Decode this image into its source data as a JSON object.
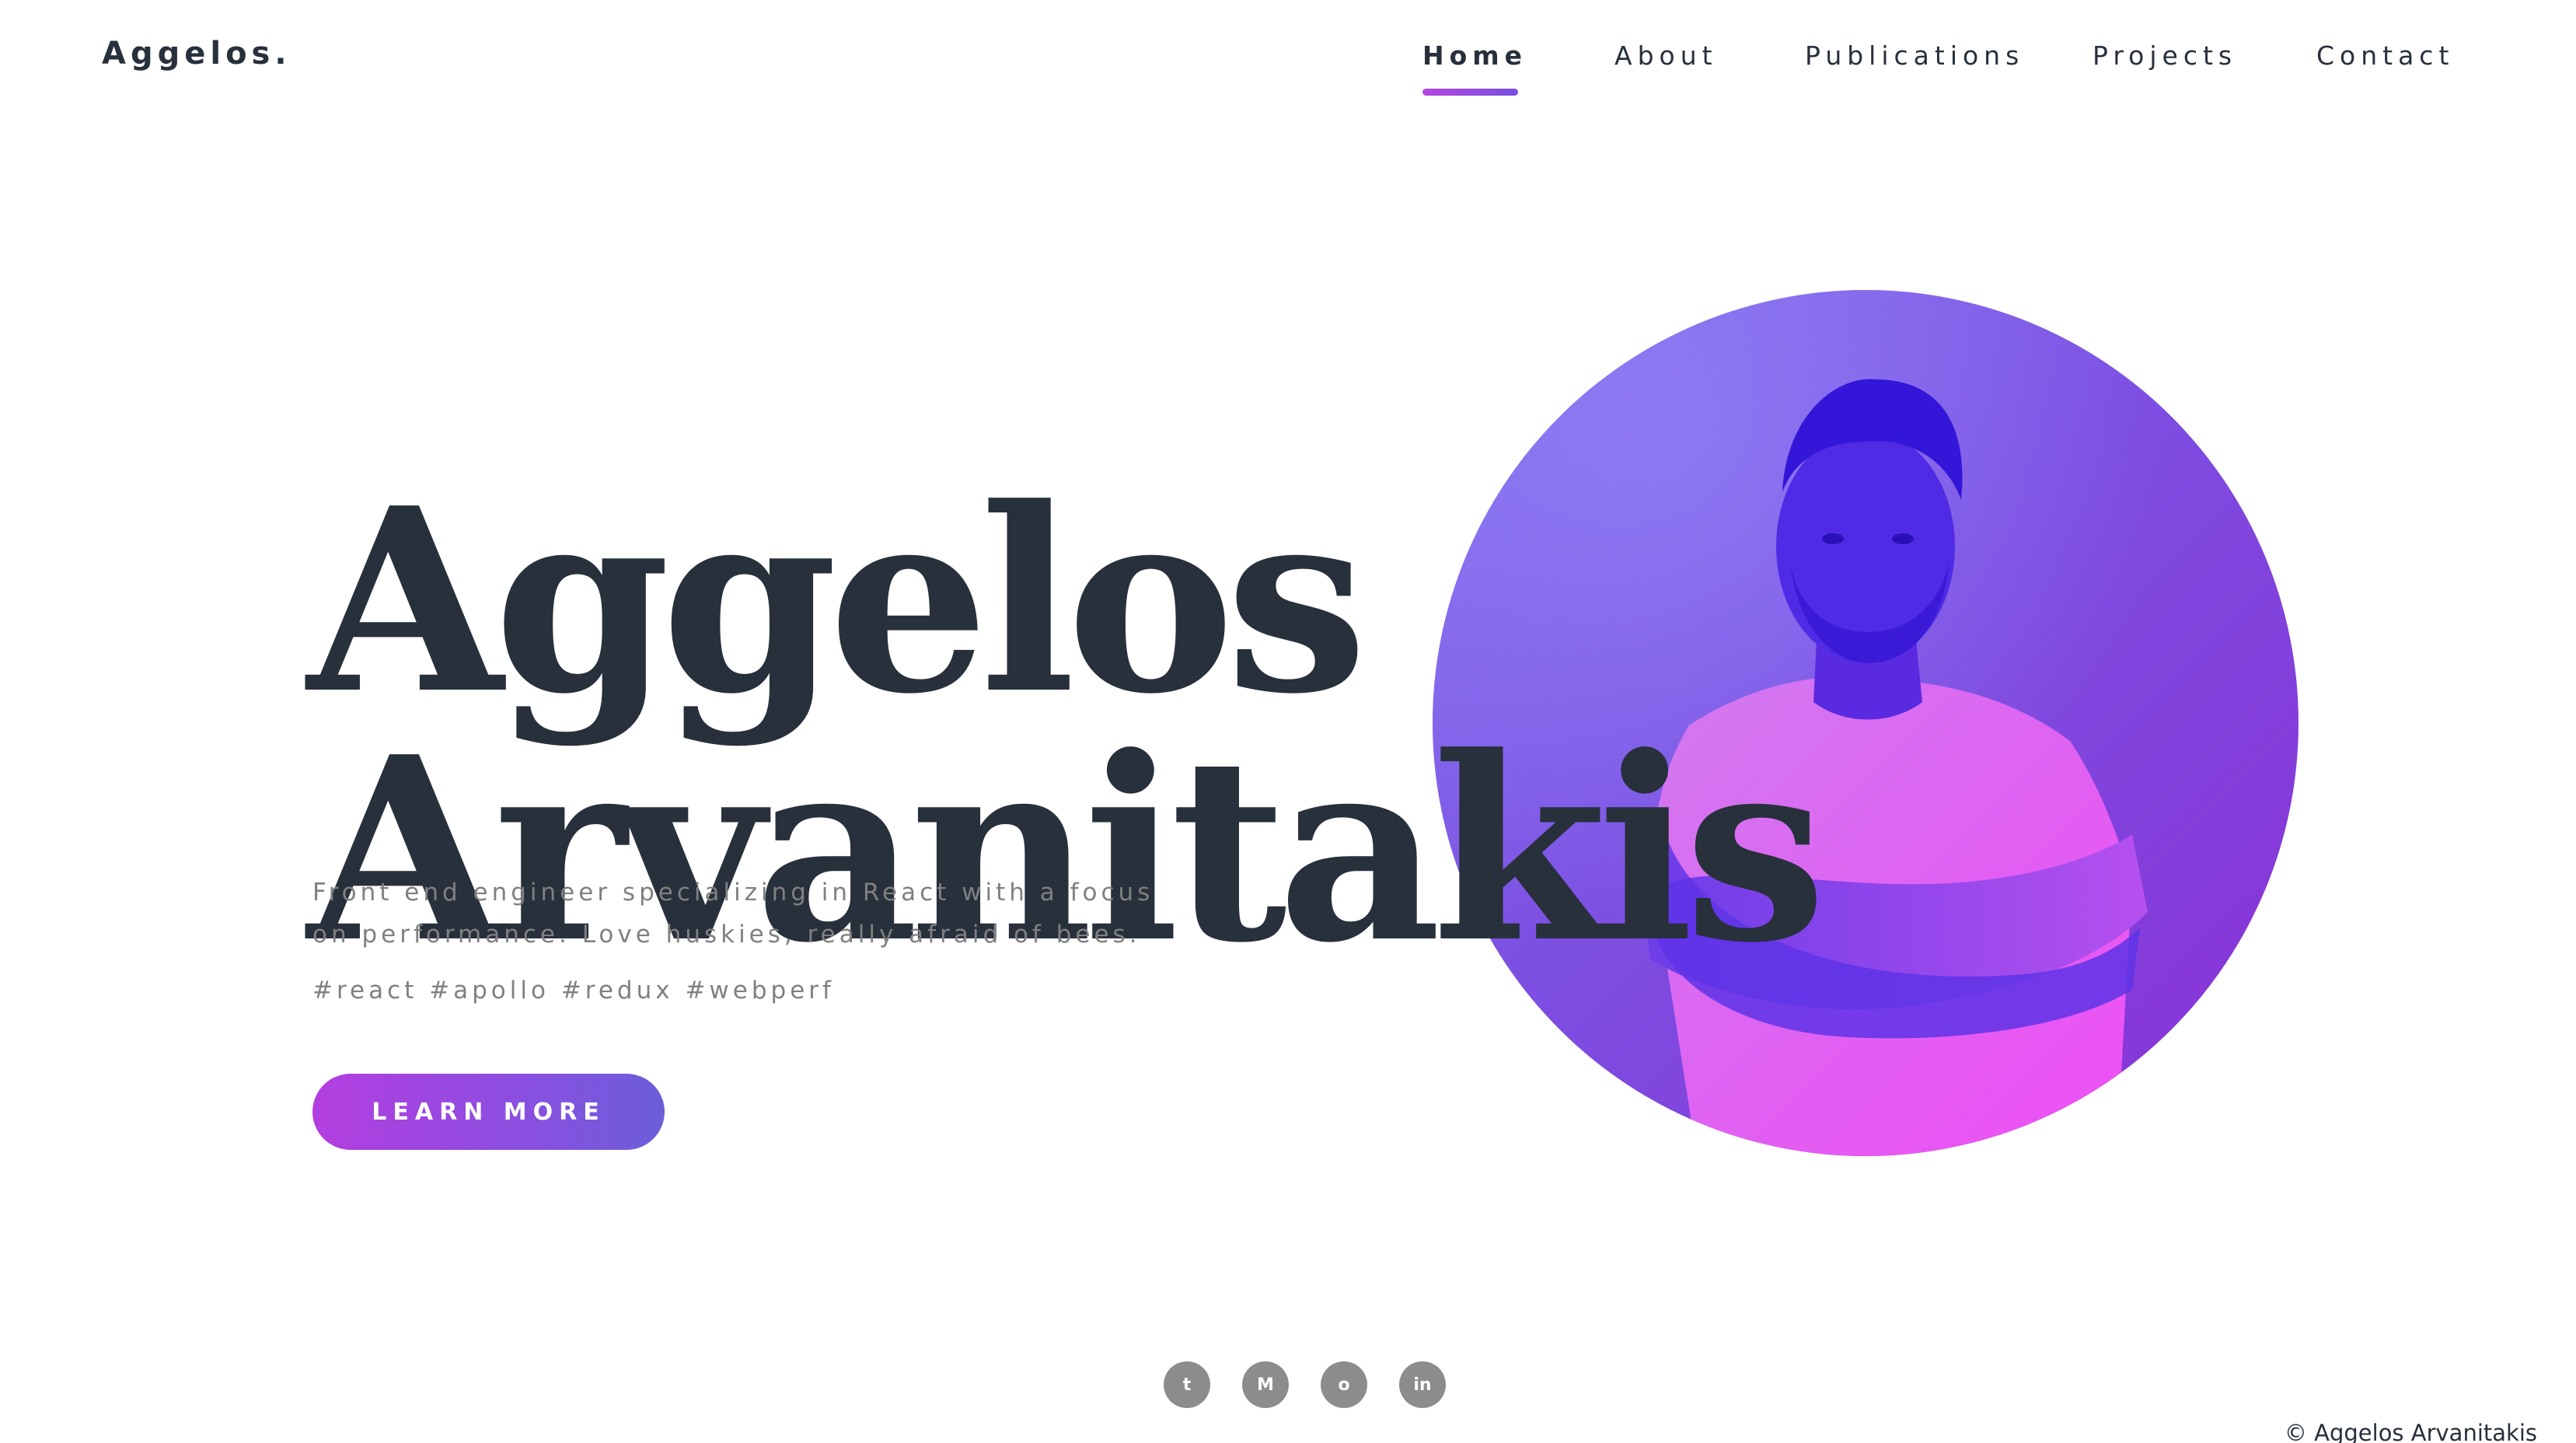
{
  "brand": {
    "name": "Aggelos."
  },
  "nav": {
    "items": [
      {
        "label": "Home",
        "active": true
      },
      {
        "label": "About",
        "active": false
      },
      {
        "label": "Publications",
        "active": false
      },
      {
        "label": "Projects",
        "active": false
      },
      {
        "label": "Contact",
        "active": false
      }
    ]
  },
  "hero": {
    "first_name": "Aggelos",
    "last_name": "Arvanitakis",
    "tagline": "Front end engineer specializing in React with a focus on performance. Love huskies, really afraid of bees.",
    "tags": "#react #apollo #redux #webperf",
    "cta_label": "LEARN MORE"
  },
  "social": [
    {
      "icon": "twitter-icon",
      "glyph": "t"
    },
    {
      "icon": "medium-icon",
      "glyph": "M"
    },
    {
      "icon": "github-icon",
      "glyph": "o"
    },
    {
      "icon": "linkedin-icon",
      "glyph": "in"
    }
  ],
  "footer": {
    "copyright": "© Aggelos Arvanitakis"
  },
  "colors": {
    "text_dark": "#27303b",
    "text_muted": "#808080",
    "accent_start": "#b43ee0",
    "accent_end": "#6b5ed9",
    "portrait_bg": "#7c4fe2",
    "social_bg": "#8c8c8c"
  }
}
